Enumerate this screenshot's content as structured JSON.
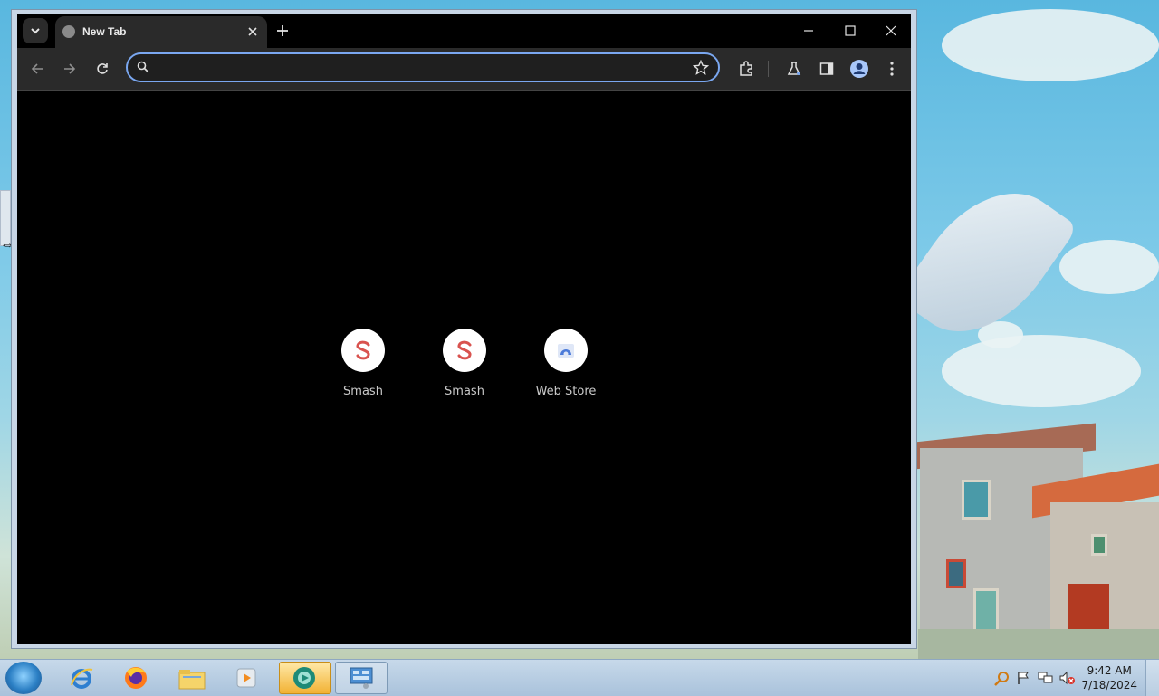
{
  "browser": {
    "tab": {
      "title": "New Tab"
    },
    "omnibox": {
      "value": "",
      "placeholder": ""
    },
    "shortcuts": [
      {
        "label": "Smash",
        "icon": "smash-icon",
        "color": "#d9534f"
      },
      {
        "label": "Smash",
        "icon": "smash-icon",
        "color": "#d9534f"
      },
      {
        "label": "Web Store",
        "icon": "web-store-icon",
        "color": "#4c7bd9"
      }
    ],
    "colors": {
      "omnibox_focus": "#7aa7f0",
      "tab_bg": "#2a2a2a",
      "page_bg": "#000000"
    }
  },
  "taskbar": {
    "apps": [
      {
        "name": "internet-explorer-icon"
      },
      {
        "name": "firefox-icon"
      },
      {
        "name": "file-explorer-icon"
      },
      {
        "name": "media-player-icon"
      },
      {
        "name": "chrome-like-app-icon"
      },
      {
        "name": "control-panel-icon"
      }
    ],
    "clock": {
      "time": "9:42 AM",
      "date": "7/18/2024"
    }
  }
}
